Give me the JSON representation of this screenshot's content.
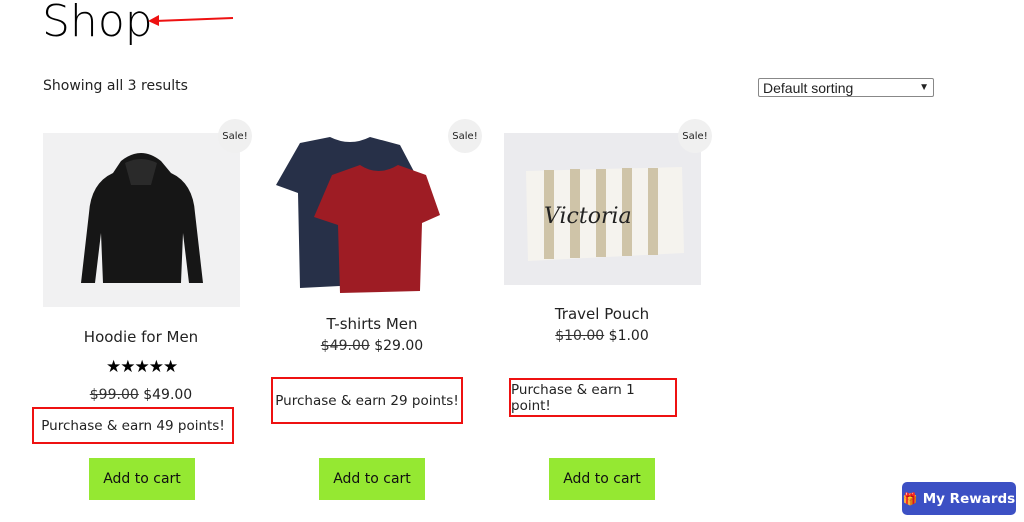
{
  "page": {
    "title": "Shop",
    "result_count": "Showing all 3 results",
    "sorting": "Default sorting"
  },
  "products": [
    {
      "name": "Hoodie for Men",
      "badge": "Sale!",
      "rating": 5,
      "stars": "★★★★★",
      "old_price": "$99.00",
      "price": "$49.00",
      "points": "Purchase & earn 49 points!",
      "button": "Add to cart"
    },
    {
      "name": "T-shirts Men",
      "badge": "Sale!",
      "old_price": "$49.00",
      "price": "$29.00",
      "points": "Purchase & earn 29 points!",
      "button": "Add to cart"
    },
    {
      "name": "Travel Pouch",
      "badge": "Sale!",
      "old_price": "$10.00",
      "price": "$1.00",
      "points": "Purchase & earn 1 point!",
      "button": "Add to cart"
    }
  ],
  "rewards": {
    "label": "My Rewards",
    "color": "#3c50c4"
  },
  "colors": {
    "annotation": "#e11111",
    "cart_button": "#95e832"
  }
}
